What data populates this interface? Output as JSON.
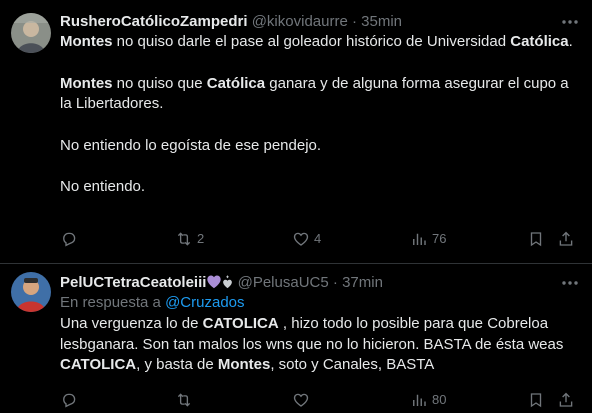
{
  "tweets": [
    {
      "name": "RusheroCatólicoZampedri",
      "handle": "@kikovidaurre",
      "dot": "·",
      "time": "35min",
      "body": [
        [
          "Montes",
          " no quiso darle el pase al goleador histórico de Universidad ",
          "Católica",
          "."
        ],
        [
          "Montes",
          " no quiso que ",
          "Católica",
          " ganara y de alguna forma asegurar el cupo a la Libertadores."
        ],
        "No entiendo lo egoísta de ese pendejo.",
        "No entiendo."
      ],
      "actions": {
        "replies": "",
        "reposts": "2",
        "likes": "4",
        "views": "76"
      }
    },
    {
      "name": "PelUCTetraCeatoleiii",
      "handle": "@PelusaUC5",
      "dot": "·",
      "time": "37min",
      "reply_prefix": "En respuesta a",
      "reply_to": "@Cruzados",
      "body": {
        "s1": "Una verguenza lo de ",
        "b1": "CATOLICA",
        "s2": " , hizo todo lo posible para que Cobreloa lesbganara. Son tan malos los wns que no lo hicieron. BASTA de ésta weas ",
        "b2": "CATOLICA",
        "s3": ", y basta de ",
        "b3": "Montes",
        "s4": ", soto y Canales, BASTA"
      },
      "actions": {
        "replies": "",
        "reposts": "",
        "likes": "",
        "views": "80"
      }
    }
  ],
  "colors": {
    "background": "#000000",
    "text": "#e7e9ea",
    "muted": "#71767b",
    "link": "#1d9bf0",
    "divider": "#2f3336"
  },
  "icons": [
    "more-icon",
    "reply-icon",
    "repost-icon",
    "like-icon",
    "views-icon",
    "bookmark-icon",
    "share-icon",
    "purple-heart-emoji",
    "sparkle-heart-emoji"
  ]
}
